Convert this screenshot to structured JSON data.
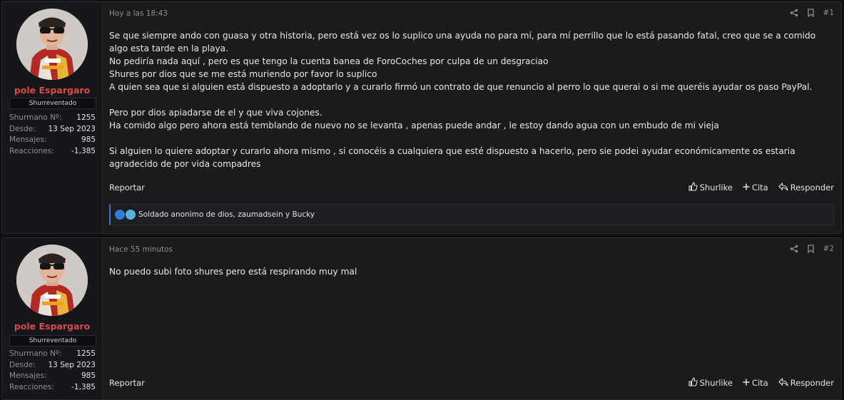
{
  "posts": [
    {
      "user": {
        "name": "pole Espargaro",
        "title": "Shurreventado",
        "stats": [
          {
            "label": "Shurmano Nº:",
            "value": "1255"
          },
          {
            "label": "Desde:",
            "value": "13 Sep 2023"
          },
          {
            "label": "Mensajes:",
            "value": "985"
          },
          {
            "label": "Reacciones:",
            "value": "-1,385"
          }
        ]
      },
      "date": "Hoy a las 18:43",
      "number": "#1",
      "paragraphs": [
        "Se que siempre ando con guasa y otra historia, pero está vez os lo suplico una ayuda no para mí, para mí perrillo que lo está pasando fatal, creo que se a comido algo esta tarde en la playa.",
        "No pediría nada aquí , pero es que tengo la cuenta banea de ForoCoches por culpa de un desgraciao",
        "Shures por dios que se me está muriendo por favor lo suplico",
        "A quien sea que si alguien está dispuesto a adoptarlo y a curarlo firmó un contrato de que renuncio al perro lo que querai o si me queréis ayudar os paso PayPal.",
        "",
        "Pero por dios apiadarse de el y que viva cojones.",
        "Ha comido algo pero ahora está temblando de nuevo no se levanta , apenas puede andar , le estoy dando agua con un embudo de mi vieja",
        "",
        "Si alguien lo quiere adoptar y curarlo ahora mismo , si conocéis a cualquiera que esté dispuesto a hacerlo, pero sie podei ayudar económicamente os estaria agradecido de por vida compadres"
      ],
      "reactions_text": "Soldado anonimo de dios, zaumadsein y Bucky"
    },
    {
      "user": {
        "name": "pole Espargaro",
        "title": "Shurreventado",
        "stats": [
          {
            "label": "Shurmano Nº:",
            "value": "1255"
          },
          {
            "label": "Desde:",
            "value": "13 Sep 2023"
          },
          {
            "label": "Mensajes:",
            "value": "985"
          },
          {
            "label": "Reacciones:",
            "value": "-1,385"
          }
        ]
      },
      "date": "Hace 55 minutos",
      "number": "#2",
      "paragraphs": [
        "No puedo subi foto shures pero está respirando muy mal"
      ]
    }
  ],
  "labels": {
    "report": "Reportar",
    "like": "Shurlike",
    "quote": "Cita",
    "reply": "Responder"
  },
  "icons": [
    "share-icon",
    "bookmark-icon",
    "thumbs-up-icon",
    "plus-icon",
    "reply-icon",
    "like-reaction-icon",
    "haha-reaction-icon"
  ],
  "colors": {
    "username": "#d94a4a",
    "reaction_border": "#3b73c9"
  }
}
